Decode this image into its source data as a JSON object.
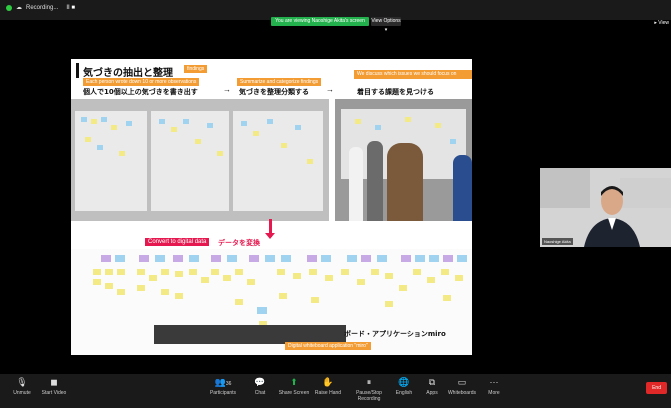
{
  "header": {
    "recording_label": "Recording...",
    "recording_controls": "II ■",
    "share_banner": "You are viewing Naoshige Akita's screen",
    "view_options": "View Options ▾",
    "view_right": "▸ View"
  },
  "slide": {
    "title_jp": "気づきの抽出と整理",
    "title_tag": "findings",
    "step1_en": "Each person wrote down 10 or more observations",
    "step1_jp": "個人で10個以上の気づきを書き出す",
    "arrow1": "→",
    "step2_en": "Summarize and categorize findings",
    "step2_jp": "気づきを整理分類する",
    "arrow2": "→",
    "step3_en": "We discuss which issues we should focus on",
    "step3_jp": "着目する課題を見つける",
    "convert_en": "Convert to digital data",
    "convert_jp": "データを変換",
    "board_jp": "ボード・アプリケーションmiro",
    "board_en": "Digital whiteboard application \"miro\""
  },
  "video": {
    "participant_name": "Naoshige Akita"
  },
  "toolbar": {
    "unmute": "Unmute",
    "start_video": "Start Video",
    "participants": "Participants",
    "participants_count": "36",
    "chat": "Chat",
    "share_screen": "Share Screen",
    "raise_hand": "Raise Hand",
    "pause_recording": "Pause/Stop Recording",
    "english": "English",
    "apps": "Apps",
    "whiteboards": "Whiteboards",
    "more": "More",
    "end": "End"
  },
  "colors": {
    "accent_orange": "#f39c33",
    "accent_pink": "#e5194f",
    "share_green": "#22b14c",
    "end_red": "#e02828"
  }
}
